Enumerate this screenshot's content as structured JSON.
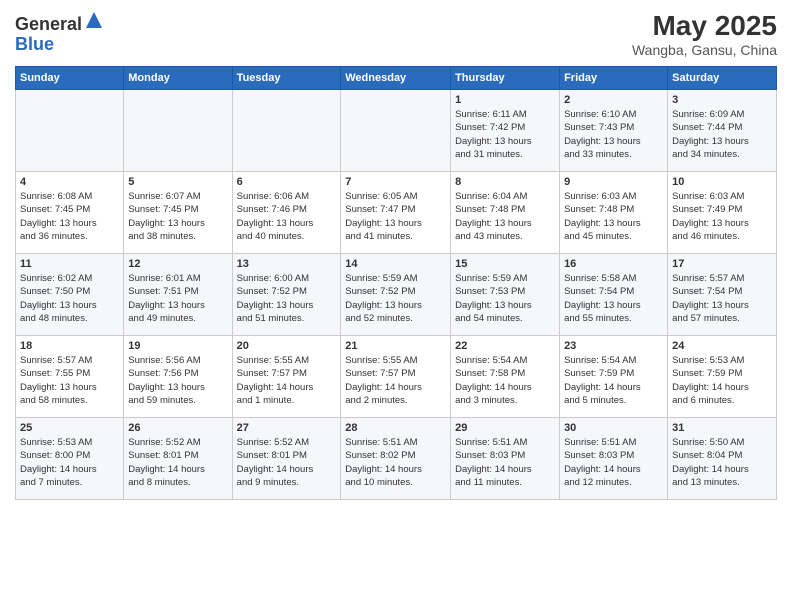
{
  "header": {
    "logo_general": "General",
    "logo_blue": "Blue",
    "month": "May 2025",
    "location": "Wangba, Gansu, China"
  },
  "weekdays": [
    "Sunday",
    "Monday",
    "Tuesday",
    "Wednesday",
    "Thursday",
    "Friday",
    "Saturday"
  ],
  "weeks": [
    [
      {
        "day": "",
        "info": ""
      },
      {
        "day": "",
        "info": ""
      },
      {
        "day": "",
        "info": ""
      },
      {
        "day": "",
        "info": ""
      },
      {
        "day": "1",
        "info": "Sunrise: 6:11 AM\nSunset: 7:42 PM\nDaylight: 13 hours\nand 31 minutes."
      },
      {
        "day": "2",
        "info": "Sunrise: 6:10 AM\nSunset: 7:43 PM\nDaylight: 13 hours\nand 33 minutes."
      },
      {
        "day": "3",
        "info": "Sunrise: 6:09 AM\nSunset: 7:44 PM\nDaylight: 13 hours\nand 34 minutes."
      }
    ],
    [
      {
        "day": "4",
        "info": "Sunrise: 6:08 AM\nSunset: 7:45 PM\nDaylight: 13 hours\nand 36 minutes."
      },
      {
        "day": "5",
        "info": "Sunrise: 6:07 AM\nSunset: 7:45 PM\nDaylight: 13 hours\nand 38 minutes."
      },
      {
        "day": "6",
        "info": "Sunrise: 6:06 AM\nSunset: 7:46 PM\nDaylight: 13 hours\nand 40 minutes."
      },
      {
        "day": "7",
        "info": "Sunrise: 6:05 AM\nSunset: 7:47 PM\nDaylight: 13 hours\nand 41 minutes."
      },
      {
        "day": "8",
        "info": "Sunrise: 6:04 AM\nSunset: 7:48 PM\nDaylight: 13 hours\nand 43 minutes."
      },
      {
        "day": "9",
        "info": "Sunrise: 6:03 AM\nSunset: 7:48 PM\nDaylight: 13 hours\nand 45 minutes."
      },
      {
        "day": "10",
        "info": "Sunrise: 6:03 AM\nSunset: 7:49 PM\nDaylight: 13 hours\nand 46 minutes."
      }
    ],
    [
      {
        "day": "11",
        "info": "Sunrise: 6:02 AM\nSunset: 7:50 PM\nDaylight: 13 hours\nand 48 minutes."
      },
      {
        "day": "12",
        "info": "Sunrise: 6:01 AM\nSunset: 7:51 PM\nDaylight: 13 hours\nand 49 minutes."
      },
      {
        "day": "13",
        "info": "Sunrise: 6:00 AM\nSunset: 7:52 PM\nDaylight: 13 hours\nand 51 minutes."
      },
      {
        "day": "14",
        "info": "Sunrise: 5:59 AM\nSunset: 7:52 PM\nDaylight: 13 hours\nand 52 minutes."
      },
      {
        "day": "15",
        "info": "Sunrise: 5:59 AM\nSunset: 7:53 PM\nDaylight: 13 hours\nand 54 minutes."
      },
      {
        "day": "16",
        "info": "Sunrise: 5:58 AM\nSunset: 7:54 PM\nDaylight: 13 hours\nand 55 minutes."
      },
      {
        "day": "17",
        "info": "Sunrise: 5:57 AM\nSunset: 7:54 PM\nDaylight: 13 hours\nand 57 minutes."
      }
    ],
    [
      {
        "day": "18",
        "info": "Sunrise: 5:57 AM\nSunset: 7:55 PM\nDaylight: 13 hours\nand 58 minutes."
      },
      {
        "day": "19",
        "info": "Sunrise: 5:56 AM\nSunset: 7:56 PM\nDaylight: 13 hours\nand 59 minutes."
      },
      {
        "day": "20",
        "info": "Sunrise: 5:55 AM\nSunset: 7:57 PM\nDaylight: 14 hours\nand 1 minute."
      },
      {
        "day": "21",
        "info": "Sunrise: 5:55 AM\nSunset: 7:57 PM\nDaylight: 14 hours\nand 2 minutes."
      },
      {
        "day": "22",
        "info": "Sunrise: 5:54 AM\nSunset: 7:58 PM\nDaylight: 14 hours\nand 3 minutes."
      },
      {
        "day": "23",
        "info": "Sunrise: 5:54 AM\nSunset: 7:59 PM\nDaylight: 14 hours\nand 5 minutes."
      },
      {
        "day": "24",
        "info": "Sunrise: 5:53 AM\nSunset: 7:59 PM\nDaylight: 14 hours\nand 6 minutes."
      }
    ],
    [
      {
        "day": "25",
        "info": "Sunrise: 5:53 AM\nSunset: 8:00 PM\nDaylight: 14 hours\nand 7 minutes."
      },
      {
        "day": "26",
        "info": "Sunrise: 5:52 AM\nSunset: 8:01 PM\nDaylight: 14 hours\nand 8 minutes."
      },
      {
        "day": "27",
        "info": "Sunrise: 5:52 AM\nSunset: 8:01 PM\nDaylight: 14 hours\nand 9 minutes."
      },
      {
        "day": "28",
        "info": "Sunrise: 5:51 AM\nSunset: 8:02 PM\nDaylight: 14 hours\nand 10 minutes."
      },
      {
        "day": "29",
        "info": "Sunrise: 5:51 AM\nSunset: 8:03 PM\nDaylight: 14 hours\nand 11 minutes."
      },
      {
        "day": "30",
        "info": "Sunrise: 5:51 AM\nSunset: 8:03 PM\nDaylight: 14 hours\nand 12 minutes."
      },
      {
        "day": "31",
        "info": "Sunrise: 5:50 AM\nSunset: 8:04 PM\nDaylight: 14 hours\nand 13 minutes."
      }
    ]
  ]
}
